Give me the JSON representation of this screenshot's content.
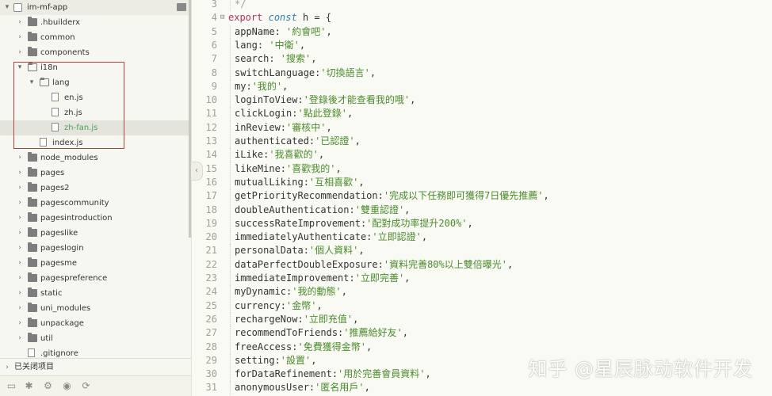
{
  "sidebar": {
    "root": "im-mf-app",
    "items": [
      {
        "label": ".hbuilderx",
        "kind": "folder"
      },
      {
        "label": "common",
        "kind": "folder"
      },
      {
        "label": "components",
        "kind": "folder"
      },
      {
        "label": "i18n",
        "kind": "folder-open"
      },
      {
        "label": "lang",
        "kind": "folder-open"
      },
      {
        "label": "en.js",
        "kind": "file"
      },
      {
        "label": "zh.js",
        "kind": "file"
      },
      {
        "label": "zh-fan.js",
        "kind": "file",
        "selected": true
      },
      {
        "label": "index.js",
        "kind": "file"
      },
      {
        "label": "node_modules",
        "kind": "folder"
      },
      {
        "label": "pages",
        "kind": "folder"
      },
      {
        "label": "pages2",
        "kind": "folder"
      },
      {
        "label": "pagescommunity",
        "kind": "folder"
      },
      {
        "label": "pagesintroduction",
        "kind": "folder"
      },
      {
        "label": "pageslike",
        "kind": "folder"
      },
      {
        "label": "pageslogin",
        "kind": "folder"
      },
      {
        "label": "pagesme",
        "kind": "folder"
      },
      {
        "label": "pagespreference",
        "kind": "folder"
      },
      {
        "label": "static",
        "kind": "folder"
      },
      {
        "label": "uni_modules",
        "kind": "folder"
      },
      {
        "label": "unpackage",
        "kind": "folder"
      },
      {
        "label": "util",
        "kind": "folder"
      },
      {
        "label": ".gitignore",
        "kind": "file"
      }
    ],
    "closed_projects": "已关闭项目",
    "toolbar_icons": [
      "folder-icon",
      "bug-icon",
      "settings-icon",
      "preview-icon",
      "sync-icon"
    ]
  },
  "editor": {
    "lines": [
      {
        "n": "3",
        "text": "*/",
        "type": "comment"
      },
      {
        "n": "4",
        "text": "export const h = {",
        "type": "header"
      },
      {
        "n": "5",
        "key": "appName: ",
        "value": "'約會吧'"
      },
      {
        "n": "6",
        "key": "lang: ",
        "value": "'中衛'"
      },
      {
        "n": "7",
        "key": "search: ",
        "value": "'搜索'"
      },
      {
        "n": "8",
        "key": "switchLanguage:",
        "value": "'切換語言'"
      },
      {
        "n": "9",
        "key": "my:",
        "value": "'我的'"
      },
      {
        "n": "10",
        "key": "loginToView:",
        "value": "'登錄後才能查看我的哦'"
      },
      {
        "n": "11",
        "key": "clickLogin:",
        "value": "'點此登錄'"
      },
      {
        "n": "12",
        "key": "inReview:",
        "value": "'審核中'"
      },
      {
        "n": "13",
        "key": "authenticated:",
        "value": "'已認證'"
      },
      {
        "n": "14",
        "key": "iLike:",
        "value": "'我喜歡的'"
      },
      {
        "n": "15",
        "key": "likeMine:",
        "value": "'喜歡我的'"
      },
      {
        "n": "16",
        "key": "mutualLiking:",
        "value": "'互相喜歡'"
      },
      {
        "n": "17",
        "key": "getPriorityRecommendation:",
        "value": "'完成以下任務即可獲得7日優先推薦'"
      },
      {
        "n": "18",
        "key": "doubleAuthentication:",
        "value": "'雙重認證'"
      },
      {
        "n": "19",
        "key": "successRateImprovement:",
        "value": "'配對成功率提升200%'"
      },
      {
        "n": "20",
        "key": "immediatelyAuthenticate:",
        "value": "'立即認證'"
      },
      {
        "n": "21",
        "key": "personalData:",
        "value": "'個人資料'"
      },
      {
        "n": "22",
        "key": "dataPerfectDoubleExposure:",
        "value": "'資料完善80%以上雙倍曝光'"
      },
      {
        "n": "23",
        "key": "immediateImprovement:",
        "value": "'立即完善'"
      },
      {
        "n": "24",
        "key": "myDynamic:",
        "value": "'我的動態'"
      },
      {
        "n": "25",
        "key": "currency:",
        "value": "'金幣'"
      },
      {
        "n": "26",
        "key": "rechargeNow:",
        "value": "'立即充值'"
      },
      {
        "n": "27",
        "key": "recommendToFriends:",
        "value": "'推薦給好友'"
      },
      {
        "n": "28",
        "key": "freeAccess:",
        "value": "'免費獲得金幣'"
      },
      {
        "n": "29",
        "key": "setting:",
        "value": "'設置'"
      },
      {
        "n": "30",
        "key": "forDataRefinement:",
        "value": "'用於完善會員資料'"
      },
      {
        "n": "31",
        "key": "anonymousUser:",
        "value": "'匿名用戶'"
      }
    ]
  },
  "watermark": "知乎 @星辰脉动软件开发",
  "colors": {
    "keyword": "#b03060",
    "string": "#4a8a2a",
    "highlight_box": "#b0443a",
    "selected_file": "#4ea05a"
  }
}
